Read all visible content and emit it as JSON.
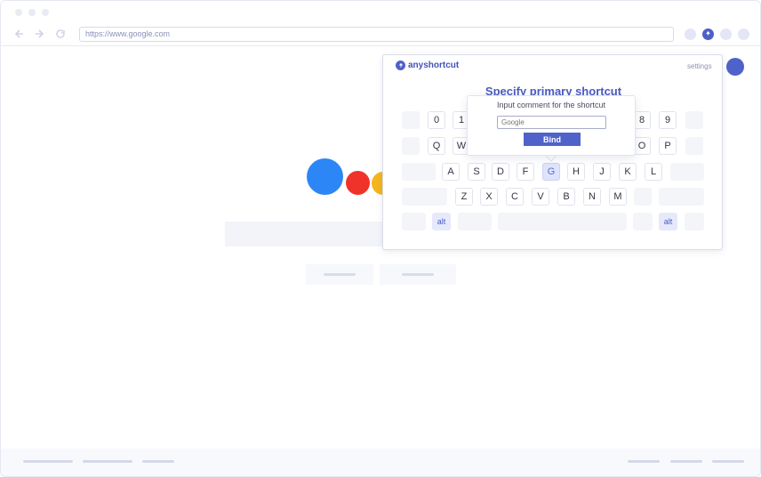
{
  "browser": {
    "address_bar": {
      "value": "https://www.google.com"
    }
  },
  "extension": {
    "logo_text": "anyshortcut",
    "settings_label": "settings",
    "title": "Specify primary shortcut",
    "keyboard": {
      "row1_left": [
        "0",
        "1"
      ],
      "row1_right": [
        "8",
        "9"
      ],
      "row2_left": [
        "Q",
        "W"
      ],
      "row2_right": [
        "O",
        "P"
      ],
      "row3": [
        "A",
        "S",
        "D",
        "F",
        "G",
        "H",
        "J",
        "K",
        "L"
      ],
      "row4": [
        "Z",
        "X",
        "C",
        "V",
        "B",
        "N",
        "M"
      ],
      "modifier_left": "alt",
      "modifier_right": "alt",
      "highlighted_key": "G"
    },
    "bind_dialog": {
      "label": "Input comment for the shortcut",
      "input_placeholder": "Google",
      "bind_button": "Bind"
    }
  },
  "colors": {
    "accent": "#4f62c9",
    "highlight": "#dfe4fb",
    "google_blue": "#2d86f5",
    "google_red": "#f1322b",
    "google_yellow": "#f5b51b"
  }
}
